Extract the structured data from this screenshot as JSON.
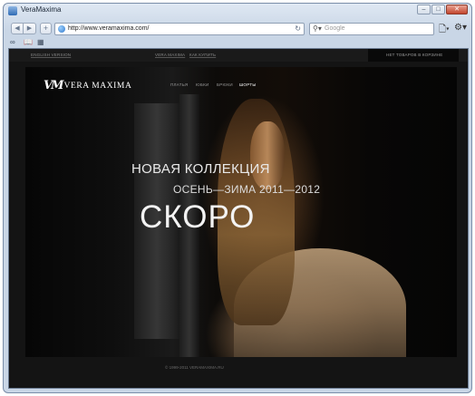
{
  "window": {
    "title": "VeraMaxima",
    "controls": [
      "–",
      "□",
      "✕"
    ]
  },
  "toolbar": {
    "back_glyph": "◀",
    "forward_glyph": "▶",
    "add_glyph": "+",
    "url": "http://www.veramaxima.com/",
    "reload_glyph": "↻",
    "search_placeholder": "Google",
    "search_glyph": "⚲▾",
    "page_menu_glyph": "🗋▾",
    "tools_menu_glyph": "⚙▾"
  },
  "bookmarks": {
    "items": [
      "∞",
      "📖",
      "▦"
    ]
  },
  "site": {
    "topbar": {
      "english": "ENGLISH VERSION",
      "about": "VERA MAXIMA",
      "howto": "КАК КУПИТЬ",
      "cart": "НЕТ ТОВАРОВ В КОРЗИНЕ"
    },
    "logo": {
      "mark": "VM",
      "text": "VERA MAXIMA"
    },
    "menu": [
      "ПЛАТЬЯ",
      "ЮБКИ",
      "БРЮКИ",
      "ШОРТЫ"
    ],
    "active_menu_index": 3,
    "hero": {
      "collection": "НОВАЯ КОЛЛЕКЦИЯ",
      "season": "ОСЕНЬ—ЗИМА 2011—2012",
      "soon": "СКОРО"
    },
    "footer": "© 1999-2011 VERAMAXIMA.RU"
  }
}
